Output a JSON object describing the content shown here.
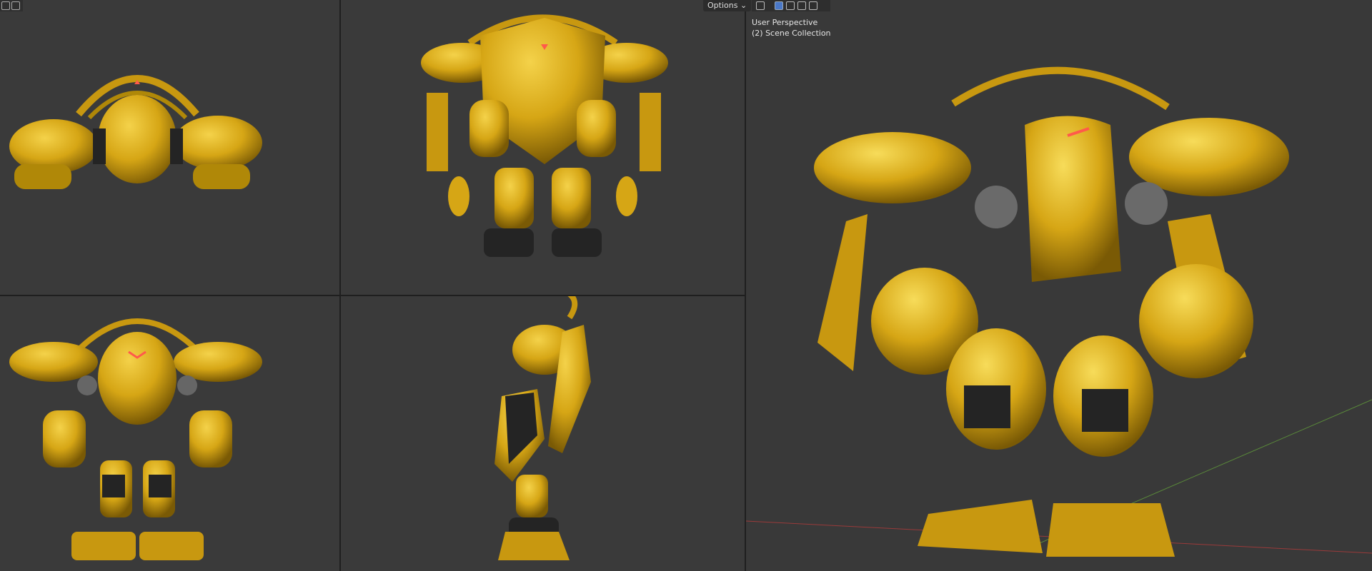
{
  "header": {
    "options_label": "Options",
    "options_arrow": "⌄"
  },
  "viewport": {
    "perspective_label": "User Perspective",
    "collection_label": "(2) Scene Collection"
  },
  "icons": {
    "left_header": [
      "view-toggle-icon",
      "view-toggle-icon"
    ],
    "right_header": [
      "select-tool-icon",
      "select-box-icon",
      "select-extend-icon",
      "select-subtract-icon",
      "select-intersect-icon"
    ]
  },
  "colors": {
    "viewport_bg": "#3a3a3a",
    "model_gold": "#d6a615",
    "model_dark": "#242424",
    "accent_red": "#ff5a4a",
    "grid_red": "#9a3a3a",
    "grid_green": "#5a8a3a"
  }
}
